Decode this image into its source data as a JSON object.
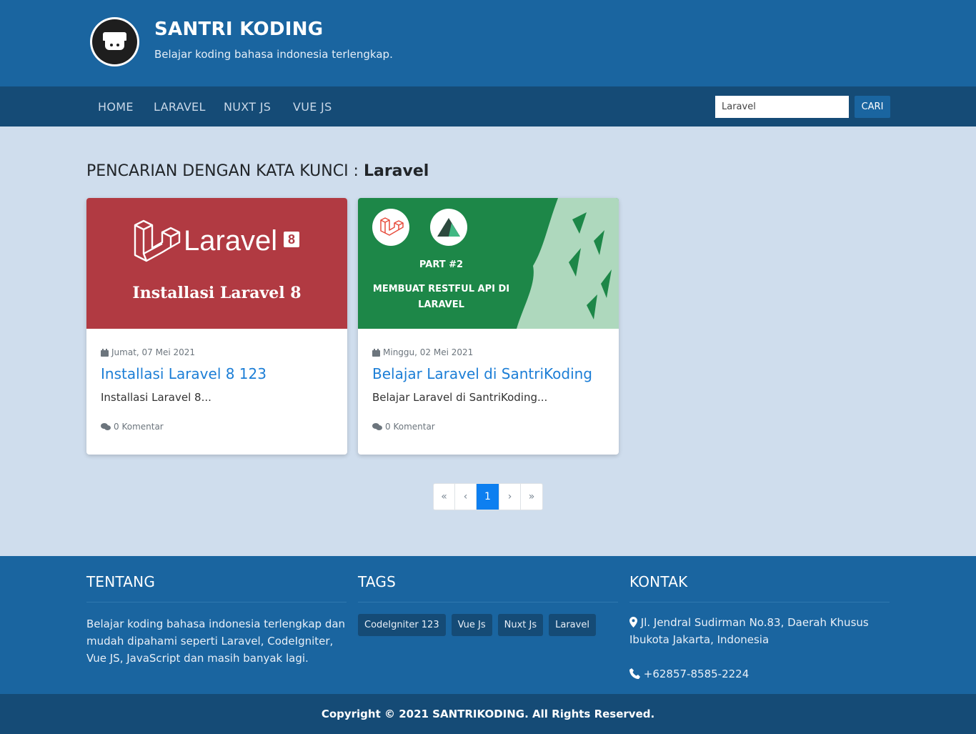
{
  "header": {
    "title": "SANTRI KODING",
    "tagline": "Belajar koding bahasa indonesia terlengkap."
  },
  "nav": {
    "items": [
      {
        "label": "HOME"
      },
      {
        "label": "LARAVEL"
      },
      {
        "label": "NUXT JS"
      },
      {
        "label": "VUE JS"
      }
    ],
    "search_value": "Laravel",
    "search_button": "CARI"
  },
  "main": {
    "heading_prefix": "PENCARIAN DENGAN KATA KUNCI : ",
    "heading_keyword": "Laravel",
    "posts": [
      {
        "image": {
          "brand": "Laravel",
          "version": "8",
          "caption": "Installasi Laravel 8",
          "background": "#b13a42"
        },
        "date": "Jumat, 07 Mei 2021",
        "title": "Installasi Laravel 8 123",
        "excerpt": "Installasi Laravel 8...",
        "comments": "0 Komentar"
      },
      {
        "image": {
          "part": "PART #2",
          "caption_line1": "MEMBUAT RESTFUL API DI",
          "caption_line2": "LARAVEL",
          "background": "#1d8748"
        },
        "date": "Minggu, 02 Mei 2021",
        "title": "Belajar Laravel di SantriKoding",
        "excerpt": "Belajar Laravel di SantriKoding...",
        "comments": "0 Komentar"
      }
    ],
    "pagination": {
      "first": "«",
      "prev": "‹",
      "current": "1",
      "next": "›",
      "last": "»"
    }
  },
  "footer": {
    "about": {
      "heading": "TENTANG",
      "text": "Belajar koding bahasa indonesia terlengkap dan mudah dipahami seperti Laravel, CodeIgniter, Vue JS, JavaScript dan masih banyak lagi."
    },
    "tags": {
      "heading": "TAGS",
      "items": [
        "CodeIgniter 123",
        "Vue Js",
        "Nuxt Js",
        "Laravel"
      ]
    },
    "contact": {
      "heading": "KONTAK",
      "address": "Jl. Jendral Sudirman No.83, Daerah Khusus Ibukota Jakarta, Indonesia",
      "phone": "+62857-8585-2224"
    },
    "copyright": "Copyright © 2021 SANTRIKODING. All Rights Reserved."
  },
  "colors": {
    "header_bg": "#1a65a0",
    "nav_bg": "#154b76",
    "page_bg": "#cfdded",
    "link": "#1c7ed6",
    "pagination_active": "#0d7ff0"
  },
  "icons": [
    "calendar-icon",
    "comments-icon",
    "map-marker-icon",
    "phone-icon",
    "laravel-logo-icon",
    "nuxt-logo-icon"
  ]
}
